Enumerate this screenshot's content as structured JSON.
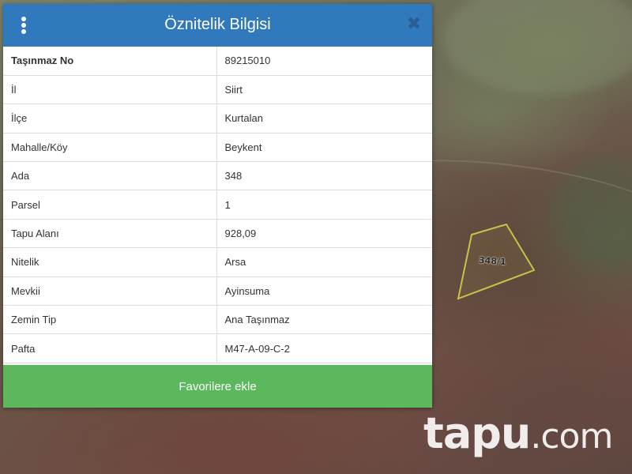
{
  "panel": {
    "title": "Öznitelik Bilgisi",
    "close_label": "✖",
    "favorite_button": "Favorilere ekle",
    "rows": [
      {
        "key": "Taşınmaz No",
        "value": "89215010"
      },
      {
        "key": "İl",
        "value": "Siirt"
      },
      {
        "key": "İlçe",
        "value": "Kurtalan"
      },
      {
        "key": "Mahalle/Köy",
        "value": "Beykent"
      },
      {
        "key": "Ada",
        "value": "348"
      },
      {
        "key": "Parsel",
        "value": "1"
      },
      {
        "key": "Tapu Alanı",
        "value": "928,09"
      },
      {
        "key": "Nitelik",
        "value": "Arsa"
      },
      {
        "key": "Mevkii",
        "value": "Ayinsuma"
      },
      {
        "key": "Zemin Tip",
        "value": "Ana Taşınmaz"
      },
      {
        "key": "Pafta",
        "value": "M47-A-09-C-2"
      }
    ]
  },
  "map": {
    "parcel_label": "348/1",
    "parcel_outline_color": "#c9c24a"
  },
  "watermark": {
    "brand": "tapu",
    "suffix": ".com"
  },
  "colors": {
    "header": "#3179bd",
    "favorite_button": "#5cb85c"
  },
  "icons": {
    "menu": "kebab-menu-icon",
    "close": "close-icon"
  }
}
